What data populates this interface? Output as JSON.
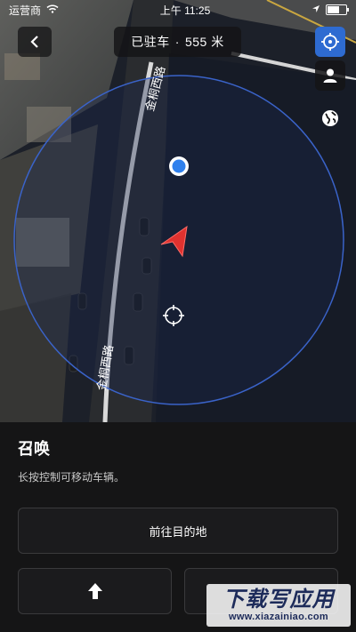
{
  "status_bar": {
    "carrier": "运营商",
    "time": "上午 11:25"
  },
  "header": {
    "back_icon": "chevron-left-icon",
    "parked_label": "已驻车",
    "separator": "·",
    "distance": "555 米"
  },
  "map": {
    "road_name": "金桐西路",
    "road_name_lower": "金桐西路"
  },
  "side_controls": [
    "crosshair-icon",
    "user-icon",
    "globe-icon"
  ],
  "panel": {
    "title": "召唤",
    "description": "长按控制可移动车辆。",
    "destination_button": "前往目的地",
    "forward_icon": "arrow-up-icon"
  },
  "watermark": {
    "main": "下载写应用",
    "sub": "www.xiazainiao.com"
  },
  "colors": {
    "accent": "#2e6bd1",
    "vehicle": "#e0322f",
    "location_dot": "#2f80ed"
  }
}
